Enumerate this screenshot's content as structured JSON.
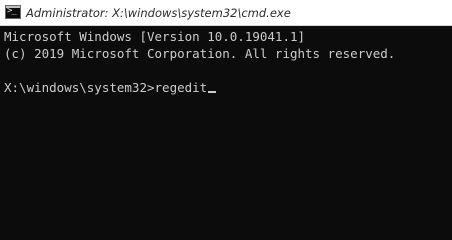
{
  "window": {
    "title": "Administrator: X:\\windows\\system32\\cmd.exe",
    "icon": "cmd-icon"
  },
  "console": {
    "lines": [
      "Microsoft Windows [Version 10.0.19041.1]",
      "(c) 2019 Microsoft Corporation. All rights reserved.",
      "",
      "X:\\windows\\system32>regedit"
    ],
    "text_color": "#cccccc",
    "background_color": "#0c0c0c"
  }
}
